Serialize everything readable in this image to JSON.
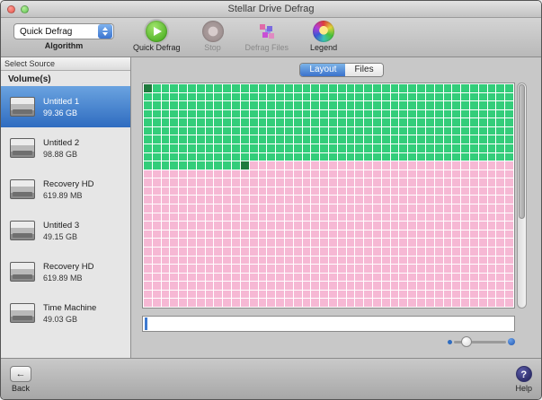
{
  "window": {
    "title": "Stellar Drive Defrag"
  },
  "toolbar": {
    "algorithm": {
      "value": "Quick Defrag",
      "label": "Algorithm"
    },
    "buttons": [
      {
        "label": "Quick Defrag",
        "enabled": true
      },
      {
        "label": "Stop",
        "enabled": false
      },
      {
        "label": "Defrag Files",
        "enabled": false
      },
      {
        "label": "Legend",
        "enabled": true
      }
    ]
  },
  "sidebar": {
    "header": "Select Source",
    "group_label": "Volume(s)",
    "volumes": [
      {
        "name": "Untitled 1",
        "size": "99.36 GB",
        "selected": true
      },
      {
        "name": "Untitled 2",
        "size": "98.88 GB",
        "selected": false
      },
      {
        "name": "Recovery HD",
        "size": "619.89 MB",
        "selected": false
      },
      {
        "name": "Untitled 3",
        "size": "49.15 GB",
        "selected": false
      },
      {
        "name": "Recovery HD",
        "size": "619.89 MB",
        "selected": false
      },
      {
        "name": "Time Machine",
        "size": "49.03 GB",
        "selected": false
      }
    ]
  },
  "main": {
    "tabs": [
      {
        "label": "Layout",
        "active": true
      },
      {
        "label": "Files",
        "active": false
      }
    ],
    "grid": {
      "cols": 42,
      "rows": 26,
      "used_full_rows": 9,
      "used_extra_cols": 12,
      "used_color": "#33cd7a",
      "free_color": "#f6b8d4",
      "markers": [
        {
          "row": 0,
          "col": 0,
          "color": "#1f7a3e"
        },
        {
          "row": 9,
          "col": 11,
          "color": "#1f7a3e"
        }
      ]
    },
    "accent_color": "#3f7ad0"
  },
  "footer": {
    "back_label": "Back",
    "back_glyph": "←",
    "help_label": "Help",
    "help_glyph": "?"
  }
}
